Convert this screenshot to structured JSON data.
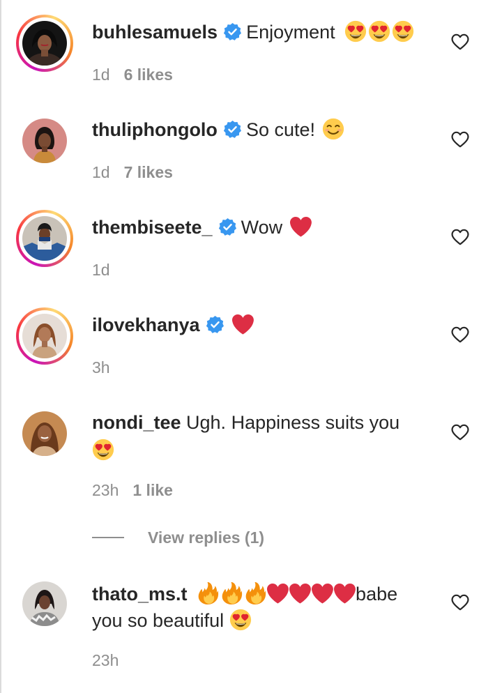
{
  "comments": [
    {
      "username": "buhlesamuels",
      "verified": true,
      "text": "Enjoyment",
      "time": "1d",
      "likes": "6 likes",
      "avatar_icon": "profile-photo"
    },
    {
      "username": "thuliphongolo",
      "verified": true,
      "text": "So cute!",
      "time": "1d",
      "likes": "7 likes",
      "avatar_icon": "profile-photo"
    },
    {
      "username": "thembiseete_",
      "verified": true,
      "text": "Wow",
      "time": "1d",
      "likes": "",
      "avatar_icon": "profile-photo"
    },
    {
      "username": "ilovekhanya",
      "verified": true,
      "text": "",
      "time": "3h",
      "likes": "",
      "avatar_icon": "profile-photo"
    },
    {
      "username": "nondi_tee",
      "verified": false,
      "text": "Ugh. Happiness suits you",
      "time": "23h",
      "likes": "1 like",
      "avatar_icon": "profile-photo"
    },
    {
      "username": "thato_ms.t",
      "verified": false,
      "text_a": "babe",
      "text_b": "you so beautiful",
      "time": "23h",
      "likes": "",
      "avatar_icon": "profile-photo"
    }
  ],
  "view_replies": "View replies (1)",
  "icons": {
    "like": "heart-outline-icon",
    "verified": "verified-badge-icon",
    "heart_eyes": "heart-eyes-emoji",
    "smile": "smiling-face-emoji",
    "red_heart": "red-heart-emoji",
    "fire": "fire-emoji"
  },
  "colors": {
    "text": "#262626",
    "secondary": "#8e8e8e",
    "verified": "#3897f0",
    "story_ring_start": "#c913b9",
    "story_ring_end": "#f58529"
  }
}
